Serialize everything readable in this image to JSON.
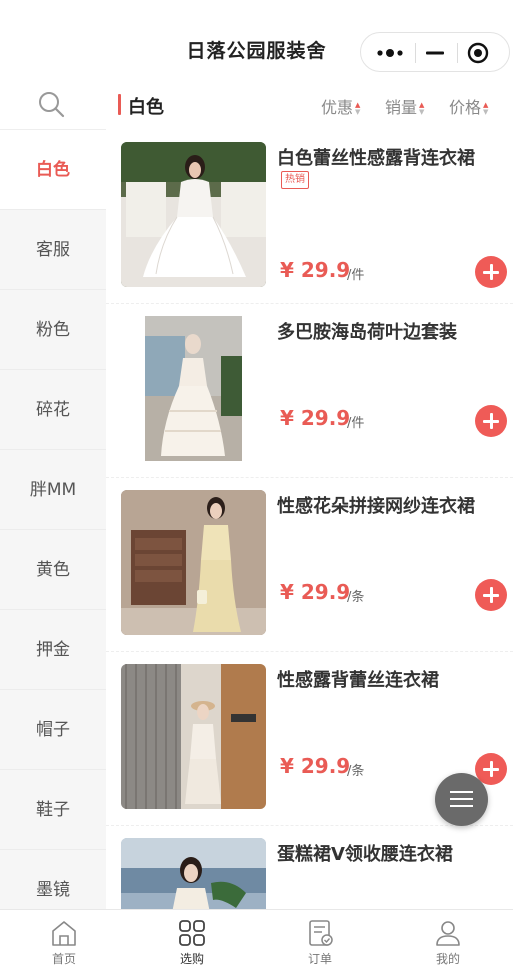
{
  "header": {
    "title": "日落公园服装舍"
  },
  "search": {
    "icon": "search-icon"
  },
  "sidebar": {
    "items": [
      {
        "label": "白色",
        "active": true
      },
      {
        "label": "客服"
      },
      {
        "label": "粉色"
      },
      {
        "label": "碎花"
      },
      {
        "label": "胖MM"
      },
      {
        "label": "黄色"
      },
      {
        "label": "押金"
      },
      {
        "label": "帽子"
      },
      {
        "label": "鞋子"
      },
      {
        "label": "墨镜"
      }
    ]
  },
  "filter": {
    "category": "白色",
    "sorts": [
      "优惠",
      "销量",
      "价格"
    ]
  },
  "products": [
    {
      "name": "白色蕾丝性感露背连衣裙",
      "badge": "热销",
      "price": "¥ 29.9",
      "unit": "/件"
    },
    {
      "name": "多巴胺海岛荷叶边套装",
      "price": "¥ 29.9",
      "unit": "/件"
    },
    {
      "name": "性感花朵拼接网纱连衣裙",
      "price": "¥ 29.9",
      "unit": "/条"
    },
    {
      "name": "性感露背蕾丝连衣裙",
      "price": "¥ 29.9",
      "unit": "/条"
    },
    {
      "name": "蛋糕裙V领收腰连衣裙",
      "price": "",
      "unit": ""
    }
  ],
  "tabbar": {
    "items": [
      {
        "label": "首页",
        "icon": "home-icon"
      },
      {
        "label": "选购",
        "icon": "grid-icon",
        "active": true
      },
      {
        "label": "订单",
        "icon": "order-icon"
      },
      {
        "label": "我的",
        "icon": "user-icon"
      }
    ]
  },
  "colors": {
    "accent": "#e95b55",
    "sidebar_bg": "#f6f6f6"
  }
}
